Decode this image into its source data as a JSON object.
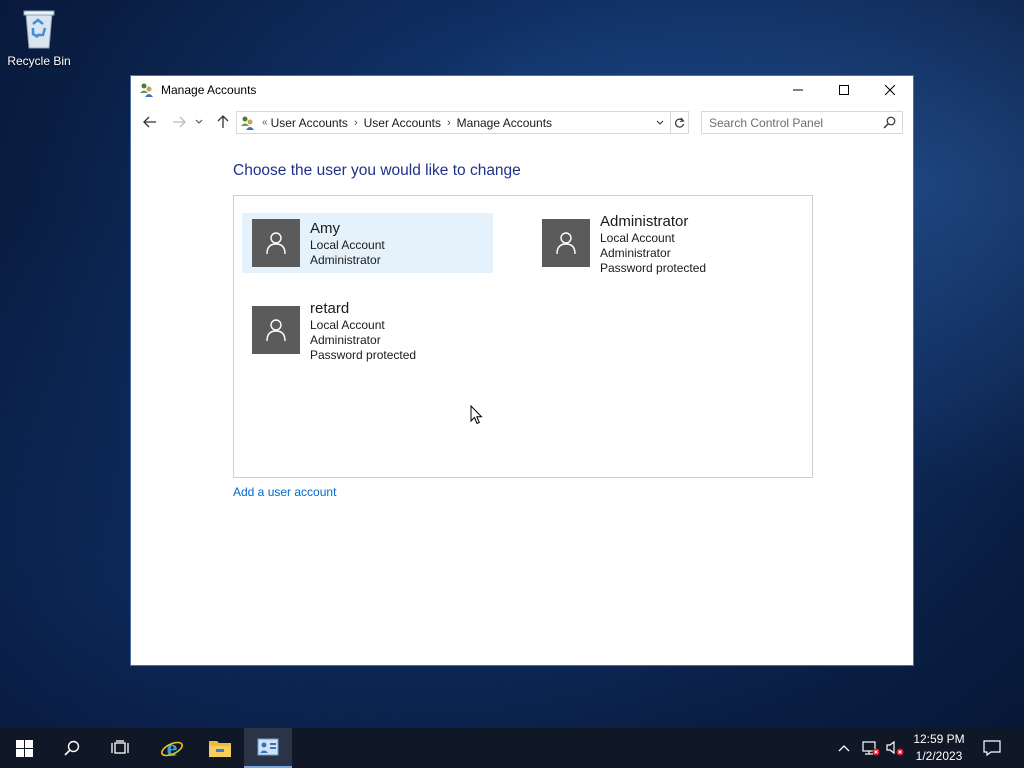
{
  "desktop": {
    "recycle_bin_label": "Recycle Bin"
  },
  "window": {
    "title": "Manage Accounts",
    "icon": "users-icon"
  },
  "address_bar": {
    "overflow": "«",
    "crumbs": [
      "User Accounts",
      "User Accounts",
      "Manage Accounts"
    ]
  },
  "search": {
    "placeholder": "Search Control Panel"
  },
  "main": {
    "heading": "Choose the user you would like to change",
    "add_link": "Add a user account",
    "accounts": [
      {
        "name": "Amy",
        "lines": [
          "Local Account",
          "Administrator"
        ],
        "selected": true
      },
      {
        "name": "Administrator",
        "lines": [
          "Local Account",
          "Administrator",
          "Password protected"
        ],
        "selected": false
      },
      {
        "name": "retard",
        "lines": [
          "Local Account",
          "Administrator",
          "Password protected"
        ],
        "selected": false
      }
    ]
  },
  "taskbar": {
    "pinned": [
      "start-icon",
      "search-icon",
      "task-view-icon",
      "internet-explorer-icon",
      "file-explorer-icon",
      "control-panel-icon"
    ],
    "active": "control-panel-icon",
    "clock_time": "12:59 PM",
    "clock_date": "1/2/2023"
  },
  "colors": {
    "heading": "#1e3287",
    "link": "#0066cc",
    "selection": "#e5f1fb",
    "avatar": "#5b5b5b",
    "taskbar": "#101726"
  }
}
